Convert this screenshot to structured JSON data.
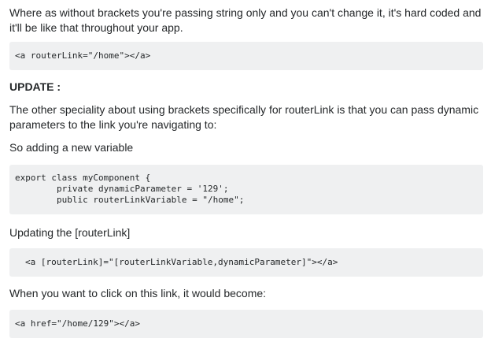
{
  "post": {
    "paragraph_1": "Where as without brackets you're passing string only and you can't change it, it's hard coded and it'll be like that throughout your app.",
    "code_1": "<a routerLink=\"/home\"></a>",
    "update_heading": "UPDATE :",
    "paragraph_2": "The other speciality about using brackets specifically for routerLink is that you can pass dynamic parameters to the link you're navigating to:",
    "paragraph_3": "So adding a new variable",
    "code_2": [
      "export class myComponent {",
      "        private dynamicParameter = '129';",
      "        public routerLinkVariable = \"/home\";"
    ],
    "paragraph_4": "Updating the [routerLink]",
    "code_3": "<a [routerLink]=\"[routerLinkVariable,dynamicParameter]\"></a>",
    "paragraph_5": "When you want to click on this link, it would become:",
    "code_4": "<a href=\"/home/129\"></a>"
  }
}
